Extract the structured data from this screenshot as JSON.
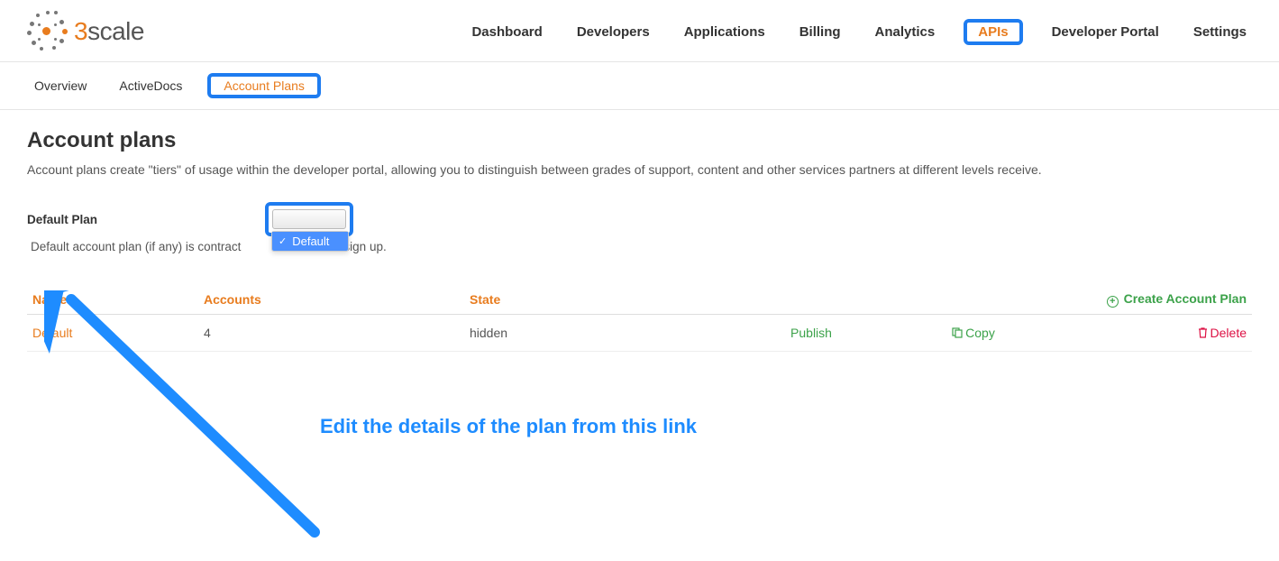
{
  "brand": {
    "prefix": "3",
    "suffix": "scale"
  },
  "main_nav": {
    "items": [
      {
        "label": "Dashboard",
        "active": false
      },
      {
        "label": "Developers",
        "active": false
      },
      {
        "label": "Applications",
        "active": false
      },
      {
        "label": "Billing",
        "active": false
      },
      {
        "label": "Analytics",
        "active": false
      },
      {
        "label": "APIs",
        "active": true
      },
      {
        "label": "Developer Portal",
        "active": false
      },
      {
        "label": "Settings",
        "active": false
      }
    ]
  },
  "sub_nav": {
    "items": [
      {
        "label": "Overview",
        "active": false
      },
      {
        "label": "ActiveDocs",
        "active": false
      },
      {
        "label": "Account Plans",
        "active": true
      }
    ]
  },
  "page": {
    "title": "Account plans",
    "description": "Account plans create \"tiers\" of usage within the developer portal, allowing you to distinguish between grades of support, content and other services partners at different levels receive.",
    "default_plan_label": "Default Plan",
    "default_plan_hint_prefix": "Default account plan (if any) is contract",
    "default_plan_hint_suffix": "on sign up.",
    "selected_option": "Default"
  },
  "table": {
    "headers": {
      "name": "Name",
      "accounts": "Accounts",
      "state": "State"
    },
    "create_label": "Create Account Plan",
    "rows": [
      {
        "name": "Default",
        "accounts": "4",
        "state": "hidden",
        "publish": "Publish",
        "copy": "Copy",
        "delete": "Delete"
      }
    ]
  },
  "annotation": {
    "text": "Edit the details of the plan from this link"
  }
}
